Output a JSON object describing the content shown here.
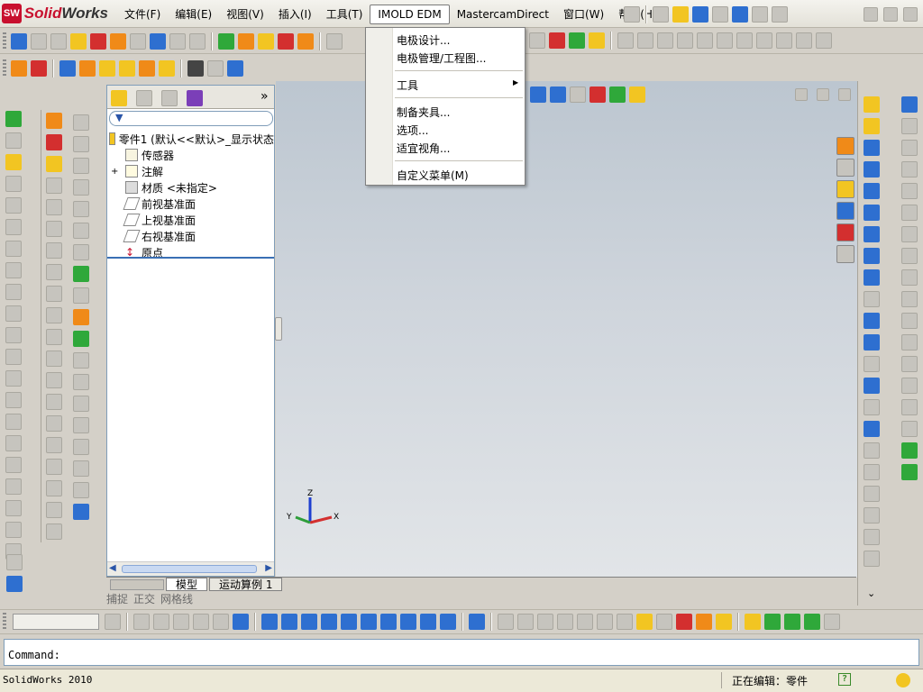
{
  "app": {
    "logo_prefix": "Solid",
    "logo_suffix": "Works",
    "badge": "SW"
  },
  "menubar": {
    "items": [
      "文件(F)",
      "编辑(E)",
      "视图(V)",
      "插入(I)",
      "工具(T)",
      "IMOLD EDM",
      "MastercamDirect",
      "窗口(W)",
      "帮助(H)"
    ],
    "active_index": 5
  },
  "dropdown": {
    "items": [
      {
        "label": "电极设计..."
      },
      {
        "label": "电极管理/工程图..."
      },
      {
        "label": "工具",
        "submenu": true
      },
      {
        "label": "制备夹具..."
      },
      {
        "label": "选项..."
      },
      {
        "label": "适宜视角..."
      },
      {
        "label": "自定义菜单(M)"
      }
    ],
    "submenu_arrow": "▶"
  },
  "feature_manager": {
    "tree": [
      {
        "label": "零件1  (默认<<默认>_显示状态",
        "icon": "part-icon"
      },
      {
        "label": "传感器",
        "icon": "sensor-icon"
      },
      {
        "label": "注解",
        "icon": "annotation-icon",
        "expander": "+"
      },
      {
        "label": "材质 <未指定>",
        "icon": "material-icon"
      },
      {
        "label": "前视基准面",
        "icon": "plane-icon"
      },
      {
        "label": "上视基准面",
        "icon": "plane-icon"
      },
      {
        "label": "右视基准面",
        "icon": "plane-icon"
      },
      {
        "label": "原点",
        "icon": "origin-icon"
      }
    ],
    "expand_glyph": "»"
  },
  "bottom_tabs": [
    "模型",
    "运动算例 1"
  ],
  "modes": [
    "捕捉",
    "正交",
    "网格线"
  ],
  "command": {
    "prompt": "Command:"
  },
  "statusbar": {
    "left": "SolidWorks 2010",
    "editing": "正在编辑：零件",
    "help": "?"
  },
  "axis": {
    "x": "X",
    "y": "Y",
    "z": "Z"
  },
  "colors": {
    "accent": "#c8102e",
    "selection": "#3a6fb4"
  }
}
